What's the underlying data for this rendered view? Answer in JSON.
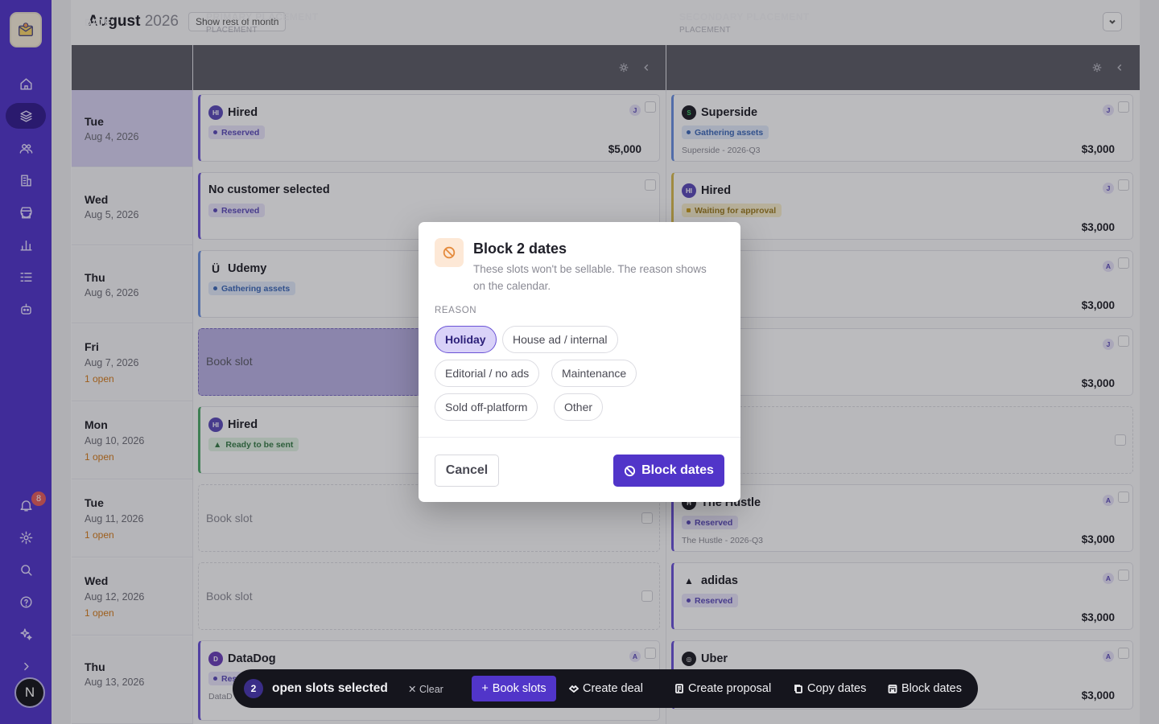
{
  "header": {
    "month": "August",
    "year": "2026",
    "show_rest": "Show rest of month"
  },
  "columns": {
    "date": "DATE",
    "primary": {
      "title": "PRIMARY PLACEMENT",
      "sub": "PLACEMENT"
    },
    "secondary": {
      "title": "SECONDARY PLACEMENT",
      "sub": "PLACEMENT"
    }
  },
  "rows": [
    {
      "day": "Tue",
      "date": "Aug 4, 2026",
      "open": ""
    },
    {
      "day": "Wed",
      "date": "Aug 5, 2026",
      "open": ""
    },
    {
      "day": "Thu",
      "date": "Aug 6, 2026",
      "open": ""
    },
    {
      "day": "Fri",
      "date": "Aug 7, 2026",
      "open": "1 open"
    },
    {
      "day": "Mon",
      "date": "Aug 10, 2026",
      "open": "1 open"
    },
    {
      "day": "Tue",
      "date": "Aug 11, 2026",
      "open": "1 open"
    },
    {
      "day": "Wed",
      "date": "Aug 12, 2026",
      "open": "1 open"
    },
    {
      "day": "Thu",
      "date": "Aug 13, 2026",
      "open": ""
    }
  ],
  "primary": {
    "r0": {
      "name": "Hired",
      "tag": "Reserved",
      "price": "$5,000",
      "initial": "J"
    },
    "r1": {
      "name": "No customer selected",
      "tag": "Reserved"
    },
    "r2": {
      "name": "Udemy",
      "tag": "Gathering assets"
    },
    "r3": {
      "book": "Book slot"
    },
    "r4": {
      "name": "Hired",
      "tag": "Ready to be sent"
    },
    "r5": {
      "book": "Book slot"
    },
    "r6": {
      "book": "Book slot"
    },
    "r7": {
      "name": "DataDog",
      "tag": "Res",
      "sub": "DataD",
      "initial": "A"
    }
  },
  "secondary": {
    "r0": {
      "name": "Superside",
      "tag": "Gathering assets",
      "sub": "Superside - 2026-Q3",
      "price": "$3,000",
      "initial": "J"
    },
    "r1": {
      "name": "Hired",
      "tag": "Waiting for approval",
      "price": "$3,000",
      "initial": "J"
    },
    "r2": {
      "tag": "ssets",
      "price": "$3,000",
      "initial": "A"
    },
    "r3": {
      "tag": "sent",
      "price": "$3,000",
      "initial": "J"
    },
    "r5": {
      "name": "The Hustle",
      "tag": "Reserved",
      "sub": "The Hustle - 2026-Q3",
      "price": "$3,000",
      "initial": "A"
    },
    "r6": {
      "name": "adidas",
      "tag": "Reserved",
      "price": "$3,000",
      "initial": "A"
    },
    "r7": {
      "name": "Uber",
      "price": "$3,000",
      "initial": "A"
    }
  },
  "sidebar": {
    "notification_count": "8",
    "avatar_initial": "N"
  },
  "modal": {
    "title": "Block 2 dates",
    "description": "These slots won't be sellable. The reason shows on the calendar.",
    "reason_label": "REASON",
    "reasons": [
      "Holiday",
      "House ad / internal",
      "Editorial / no ads",
      "Maintenance",
      "Sold off-platform",
      "Other"
    ],
    "selected": "Holiday",
    "cancel": "Cancel",
    "confirm": "Block dates"
  },
  "actionbar": {
    "count": "2",
    "text": "open slots selected",
    "clear": "Clear",
    "book": "Book slots",
    "create_deal": "Create deal",
    "create_proposal": "Create proposal",
    "copy_dates": "Copy dates",
    "block_dates": "Block dates"
  },
  "colors": {
    "accent": "#5135c9",
    "sidebar": "#5135c9",
    "warning": "#e48a3c"
  }
}
